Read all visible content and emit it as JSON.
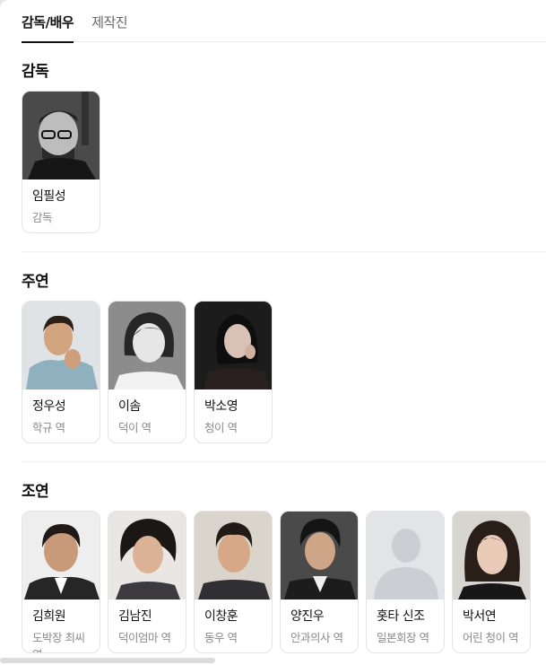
{
  "tabs": [
    {
      "label": "감독/배우",
      "active": true
    },
    {
      "label": "제작진",
      "active": false
    }
  ],
  "sections": {
    "director": {
      "title": "감독",
      "people": [
        {
          "name": "임필성",
          "role": "감독",
          "photo_style": "bw-portrait-glasses"
        }
      ]
    },
    "lead": {
      "title": "주연",
      "people": [
        {
          "name": "정우성",
          "role": "학규 역",
          "photo_style": "color-man-sweater"
        },
        {
          "name": "이솜",
          "role": "덕이 역",
          "photo_style": "bw-woman-smile"
        },
        {
          "name": "박소영",
          "role": "청이 역",
          "photo_style": "dark-woman"
        }
      ]
    },
    "supporting": {
      "title": "조연",
      "people": [
        {
          "name": "김희원",
          "role": "도박장 최씨 역",
          "photo_style": "man-suit"
        },
        {
          "name": "김남진",
          "role": "덕이엄마 역",
          "photo_style": "woman-curly"
        },
        {
          "name": "이창훈",
          "role": "동우 역",
          "photo_style": "man-plain"
        },
        {
          "name": "양진우",
          "role": "안과의사 역",
          "photo_style": "man-dark-bg"
        },
        {
          "name": "홋타 신조",
          "role": "일본회장 역",
          "photo_style": "placeholder-silhouette"
        },
        {
          "name": "박서연",
          "role": "어린 청이 역",
          "photo_style": "young-woman"
        }
      ]
    }
  },
  "colors": {
    "tab_active": "#111111",
    "tab_inactive": "#666666",
    "role_text": "#8a8a8a",
    "card_border": "#e4e4e4"
  }
}
